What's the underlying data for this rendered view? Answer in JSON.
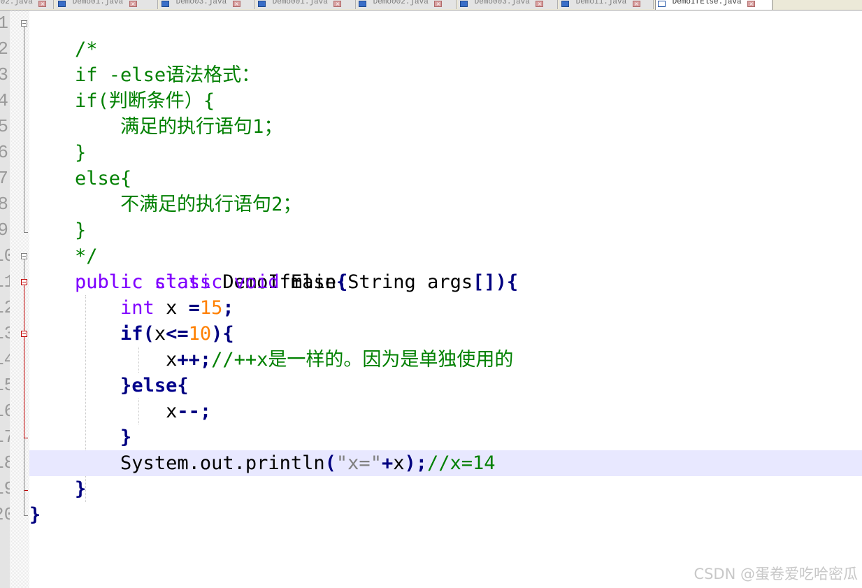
{
  "tabs": [
    {
      "label": "o02.java",
      "active": false
    },
    {
      "label": "Demo01.java",
      "active": false
    },
    {
      "label": "Demo03.java",
      "active": false
    },
    {
      "label": "Demo001.java",
      "active": false
    },
    {
      "label": "Demo002.java",
      "active": false
    },
    {
      "label": "Demo003.java",
      "active": false
    },
    {
      "label": "Demo11.java",
      "active": false
    },
    {
      "label": "DemoIfElse.java",
      "active": true
    }
  ],
  "line_numbers": [
    "1",
    "2",
    "3",
    "4",
    "5",
    "6",
    "7",
    "8",
    "9",
    "10",
    "11",
    "12",
    "13",
    "14",
    "15",
    "16",
    "17",
    "18",
    "19",
    "20"
  ],
  "current_line": 18,
  "code": {
    "l1": {
      "a": "/*"
    },
    "l2": {
      "a": "if -else",
      "b": "语法格式：",
      "c": ""
    },
    "l3": {
      "a": "if(",
      "b": "判断条件）",
      "c": "{"
    },
    "l4": {
      "a": "    ",
      "b": "满足的执行语句",
      "c": "1；"
    },
    "l5": {
      "a": "}"
    },
    "l6": {
      "a": "else{"
    },
    "l7": {
      "a": "    ",
      "b": "不满足的执行语句",
      "c": "2；"
    },
    "l8": {
      "a": "}"
    },
    "l9": {
      "a": "*/"
    },
    "l10": {
      "kw1": "public",
      "kw2": "class",
      "name": "DemoIfElse",
      "brace": "{"
    },
    "l11": {
      "kw1": "public",
      "kw2": "static",
      "kw3": "void",
      "name": "main",
      "p1": "(",
      "type": "String",
      "arg": "args",
      "br": "[])",
      "brace": "{"
    },
    "l12": {
      "kw": "int",
      "var": "x",
      "op": "=",
      "num": "15",
      "semi": ";"
    },
    "l13": {
      "kw": "if",
      "p1": "(",
      "var": "x",
      "op": "<=",
      "num": "10",
      "p2": ")",
      "brace": "{"
    },
    "l14": {
      "var": "x",
      "op": "++",
      "semi": ";",
      "comment": "//++x",
      "comment_cn": "是一样的。因为是单独使用的"
    },
    "l15": {
      "b1": "}",
      "kw": "else",
      "b2": "{"
    },
    "l16": {
      "var": "x",
      "op": "--",
      "semi": ";"
    },
    "l17": {
      "b1": "}"
    },
    "l18": {
      "obj": "System.out.println",
      "p1": "(",
      "str": "\"x=\"",
      "op": "+",
      "var": "x",
      "p2": ")",
      "semi": ";",
      "comment": "//x=14"
    },
    "l19": {
      "b1": "}"
    },
    "l20": {
      "b1": "}"
    }
  },
  "watermark": "CSDN @蛋卷爱吃哈密瓜",
  "colors": {
    "comment": "#008000",
    "keyword": "#8000ff",
    "keyword_bold": "#00008b",
    "number": "#ff8000",
    "string": "#808080",
    "current_line": "#e8e8ff"
  }
}
